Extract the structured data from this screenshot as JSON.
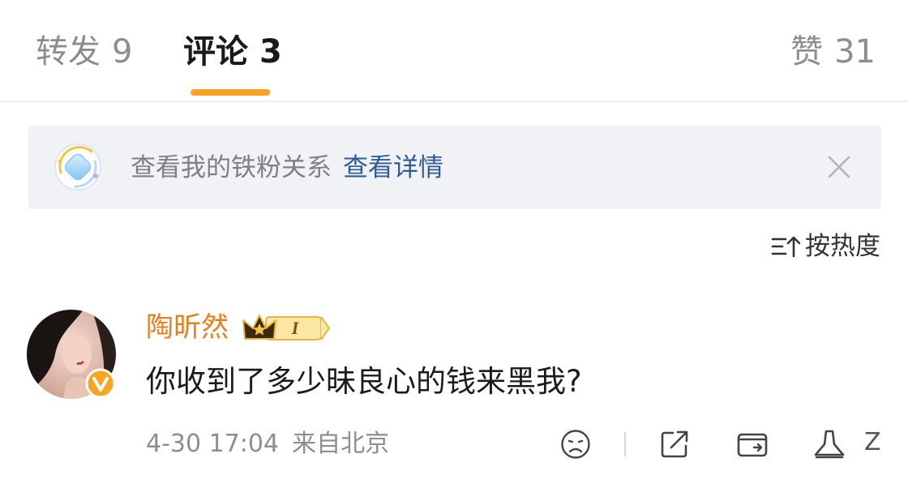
{
  "tabs": {
    "repost": {
      "label": "转发",
      "count": "9"
    },
    "comment": {
      "label": "评论",
      "count": "3"
    },
    "like": {
      "label": "赞",
      "count": "31"
    }
  },
  "banner": {
    "text": "查看我的铁粉关系",
    "link": "查看详情",
    "icon": "fan-relation-icon",
    "close_icon": "close-icon"
  },
  "sort": {
    "label": "按热度",
    "icon": "sort-icon"
  },
  "comment": {
    "username": "陶昕然",
    "badge_level": "I",
    "text": "你收到了多少昧良心的钱来黑我?",
    "date": "4-30 17:04",
    "source": "来自北京",
    "actions": [
      "emoji-react-icon",
      "share-icon",
      "repost-icon",
      "like-icon"
    ],
    "tail_text": "Z"
  },
  "colors": {
    "accent": "#f4a428",
    "username": "#e5801e",
    "link": "#2f5b93",
    "banner_bg": "#f1f2f5"
  }
}
